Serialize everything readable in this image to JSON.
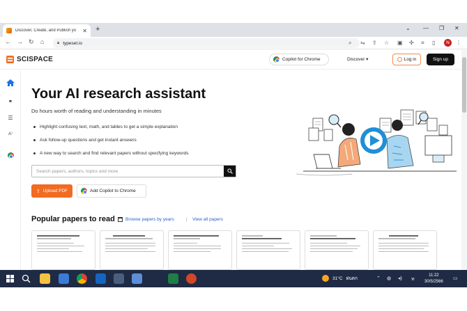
{
  "browser": {
    "tab_title": "Discover, Create, and Publish yo",
    "url": "typeset.io",
    "new_tab_glyph": "+",
    "profile_initial": "N"
  },
  "site": {
    "logo": "SCISPACE",
    "copilot_label": "Copilot for Chrome",
    "discover_label": "Discover",
    "login_label": "Log in",
    "signup_label": "Sign up"
  },
  "hero": {
    "title": "Your AI research assistant",
    "subtitle": "Do hours worth of reading and understanding in minutes",
    "features": [
      "Highlight confusing text, math, and tables to get a simple explanation",
      "Ask follow-up questions and get instant answers",
      "A new way to search and find relevant papers without specifying keywords"
    ],
    "search_placeholder": "Search papers, authors, topics and more",
    "upload_label": "Upload PDF",
    "add_copilot_label": "Add Copilot to Chrome"
  },
  "popular": {
    "title": "Popular papers to read",
    "browse_label": "Browse papers by years",
    "separator": "|",
    "all_papers_label": "View all papers"
  },
  "taskbar": {
    "temperature": "31°C",
    "weather_text": "ฝนตก",
    "time": "11:22",
    "date": "30/5/2566"
  },
  "colors": {
    "brand_orange": "#f26b21",
    "link_blue": "#2a63c7",
    "taskbar_bg": "#1f2a44",
    "hero_accent": "#1f8fd6"
  },
  "icons": [
    "home-icon",
    "quote-icon",
    "list-icon",
    "ai-icon",
    "chrome-icon",
    "search-icon",
    "upload-icon",
    "calendar-icon",
    "lock-icon",
    "play-icon"
  ]
}
